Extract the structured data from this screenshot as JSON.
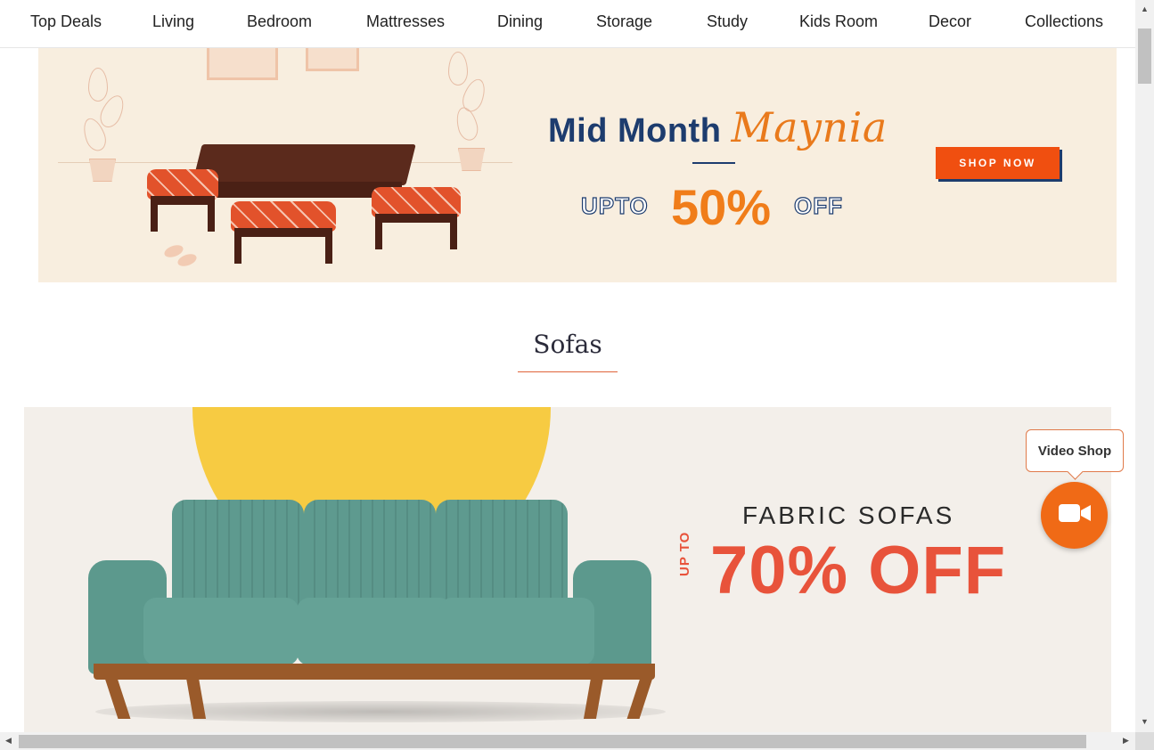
{
  "nav": {
    "items": [
      "Top Deals",
      "Living",
      "Bedroom",
      "Mattresses",
      "Dining",
      "Storage",
      "Study",
      "Kids Room",
      "Decor",
      "Collections"
    ]
  },
  "promo_banner": {
    "title_part1": "Mid Month ",
    "title_script": "Maynia",
    "upto": "UPTO",
    "percent": "50%",
    "off": "OFF",
    "cta": "SHOP NOW",
    "colors": {
      "background": "#f8eedf",
      "title": "#1d3c6e",
      "accent": "#f07d1a",
      "cta": "#f04f10"
    }
  },
  "section": {
    "title": "Sofas"
  },
  "sofa_banner": {
    "title": "FABRIC SOFAS",
    "upto": "UP TO",
    "offer": "70% OFF",
    "colors": {
      "background": "#f3efea",
      "sun": "#f7cb42",
      "offer": "#e8533b",
      "sofa": "#5e9a8f"
    }
  },
  "video_shop": {
    "tooltip": "Video Shop",
    "icon": "video-camera-icon",
    "color": "#f06a16"
  }
}
